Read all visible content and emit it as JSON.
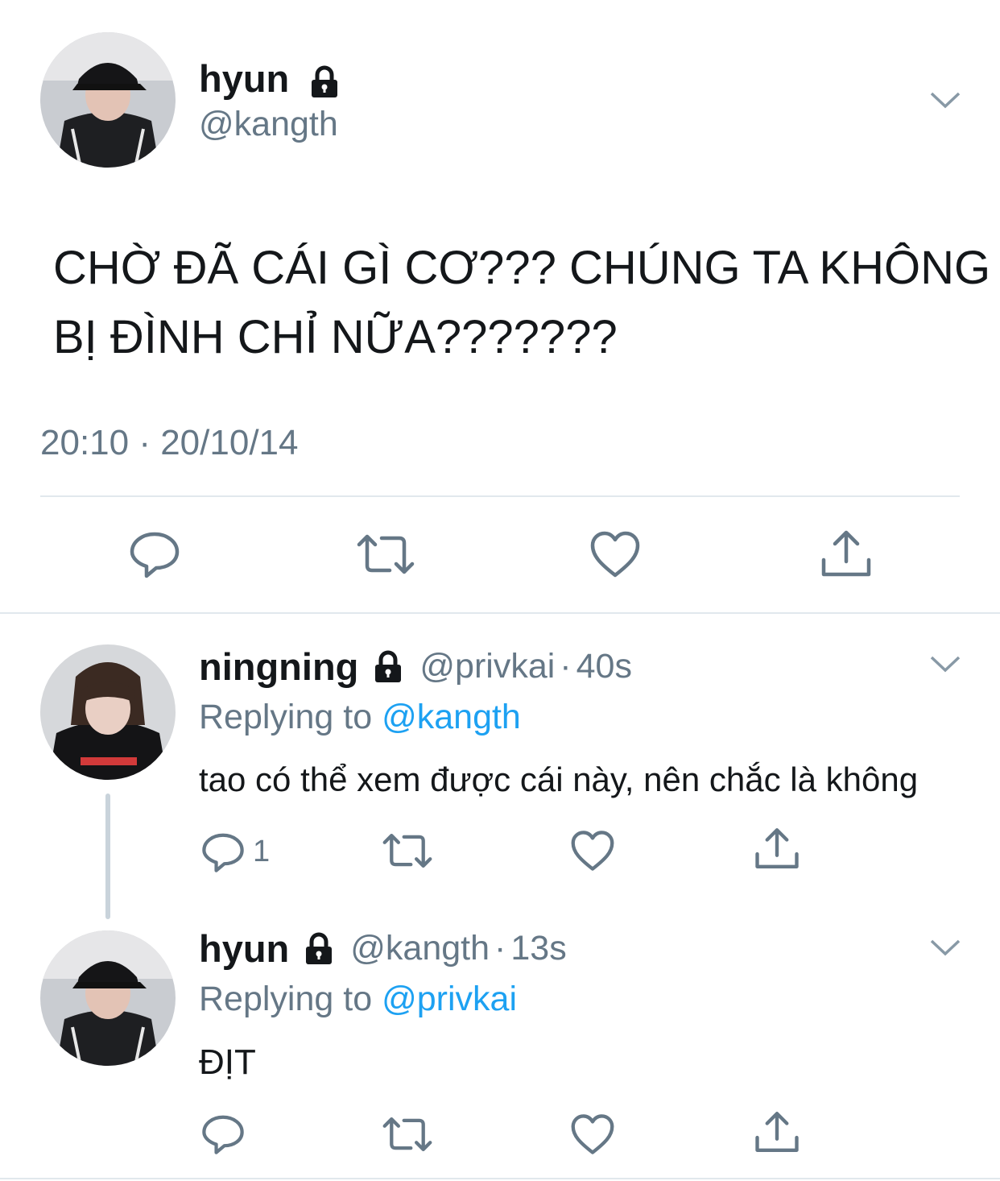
{
  "main_tweet": {
    "name": "hyun",
    "handle": "@kangth",
    "text_line1": "CHỜ ĐÃ CÁI GÌ CƠ??? CHÚNG TA KHÔNG",
    "text_line2": "BỊ ĐÌNH CHỈ NỮA???????",
    "timestamp": "20:10 · 20/10/14"
  },
  "reply1": {
    "name": "ningning",
    "handle": "@privkai",
    "sep": "·",
    "time": "40s",
    "replying_label": "Replying to",
    "replying_handle": "@kangth",
    "text": "tao có thể xem được cái này, nên chắc là không",
    "reply_count": "1"
  },
  "reply2": {
    "name": "hyun",
    "handle": "@kangth",
    "sep": "·",
    "time": "13s",
    "replying_label": "Replying to",
    "replying_handle": "@privkai",
    "text": "ĐỊT"
  },
  "icons": [
    "lock-icon",
    "chevron-down-icon",
    "reply-icon",
    "retweet-icon",
    "like-icon",
    "share-icon"
  ],
  "colors": {
    "text": "#14171a",
    "muted": "#657786",
    "link": "#1da1f2",
    "divider": "#e1e8ed"
  }
}
